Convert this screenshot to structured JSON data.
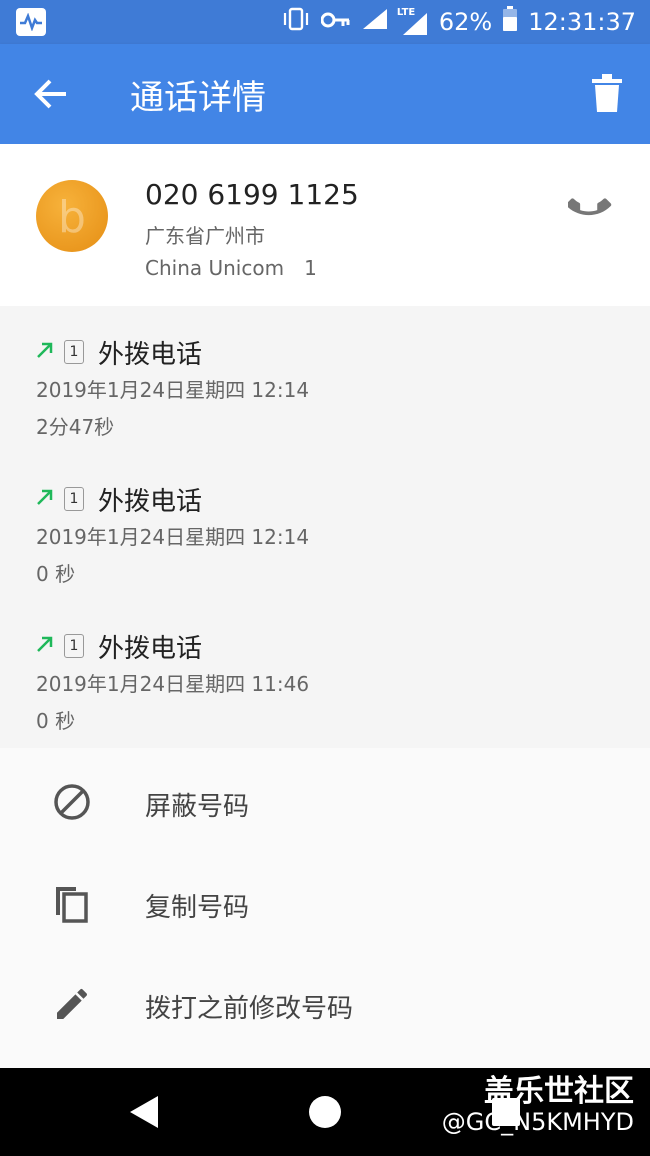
{
  "status_bar": {
    "battery": "62%",
    "time": "12:31:37",
    "network": "LTE",
    "icons": [
      "activity-icon",
      "vibrate-icon",
      "vpn-key-icon",
      "signal-icon",
      "signal-lte-icon",
      "battery-icon"
    ]
  },
  "app_bar": {
    "title": "通话详情",
    "back_icon": "arrow-left-icon",
    "delete_icon": "trash-icon"
  },
  "contact": {
    "number": "020 6199 1125",
    "location": "广东省广州市",
    "carrier": "China Unicom　1",
    "call_icon": "phone-icon"
  },
  "call_log": [
    {
      "sim": "1",
      "type": "外拨电话",
      "datetime": "2019年1月24日星期四 12:14",
      "duration": "2分47秒",
      "direction_icon": "outgoing-arrow-icon"
    },
    {
      "sim": "1",
      "type": "外拨电话",
      "datetime": "2019年1月24日星期四 12:14",
      "duration": "0 秒",
      "direction_icon": "outgoing-arrow-icon"
    },
    {
      "sim": "1",
      "type": "外拨电话",
      "datetime": "2019年1月24日星期四 11:46",
      "duration": "0 秒",
      "direction_icon": "outgoing-arrow-icon"
    }
  ],
  "actions": [
    {
      "label": "屏蔽号码",
      "icon": "block-icon"
    },
    {
      "label": "复制号码",
      "icon": "copy-icon"
    },
    {
      "label": "拨打之前修改号码",
      "icon": "edit-pencil-icon"
    }
  ],
  "watermark": {
    "line1": "盖乐世社区",
    "line2": "@GC_N5KMHYD"
  },
  "colors": {
    "app_bar": "#4285e6",
    "status_bar": "#3f7bd6",
    "outgoing_arrow": "#1fb85a",
    "avatar": "#f0a02c"
  }
}
